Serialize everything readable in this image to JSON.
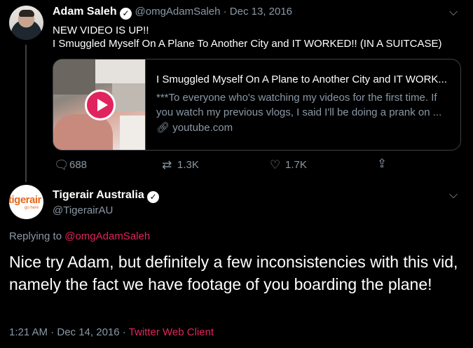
{
  "tweet1": {
    "name": "Adam Saleh",
    "handle_date": "@omgAdamSaleh · Dec 13, 2016",
    "text_line1": "NEW VIDEO IS UP!!",
    "text_line2": "I Smuggled Myself On A Plane To Another City and IT WORKED!! (IN A SUITCASE)",
    "card": {
      "title": "I Smuggled Myself On A Plane to Another City and IT WORK...",
      "description": "***To everyone who's watching my videos for the first time. If you watch my previous vlogs, I said I'll be doing a prank on ...",
      "link": "youtube.com"
    },
    "replies": "688",
    "retweets": "1.3K",
    "likes": "1.7K"
  },
  "tweet2": {
    "name": "Tigerair Australia",
    "handle": "@TigerairAU",
    "avatar_text": "tigerair",
    "avatar_subtext": "go here",
    "replying_prefix": "Replying to",
    "replying_handle": "@omgAdamSaleh",
    "text": "Nice try Adam, but definitely a few inconsistencies with this vid, namely the fact we have footage of you boarding the plane!",
    "timestamp": "1:21 AM · Dec 14, 2016 ·",
    "client": "Twitter Web Client"
  },
  "colors": {
    "background": "#000000",
    "accent": "#e0245e",
    "muted": "#8b98a5",
    "border": "#3d4146"
  },
  "icons": [
    "reply-icon",
    "retweet-icon",
    "like-icon",
    "share-icon",
    "verified-icon",
    "chevron-down-icon",
    "link-icon",
    "play-icon"
  ]
}
